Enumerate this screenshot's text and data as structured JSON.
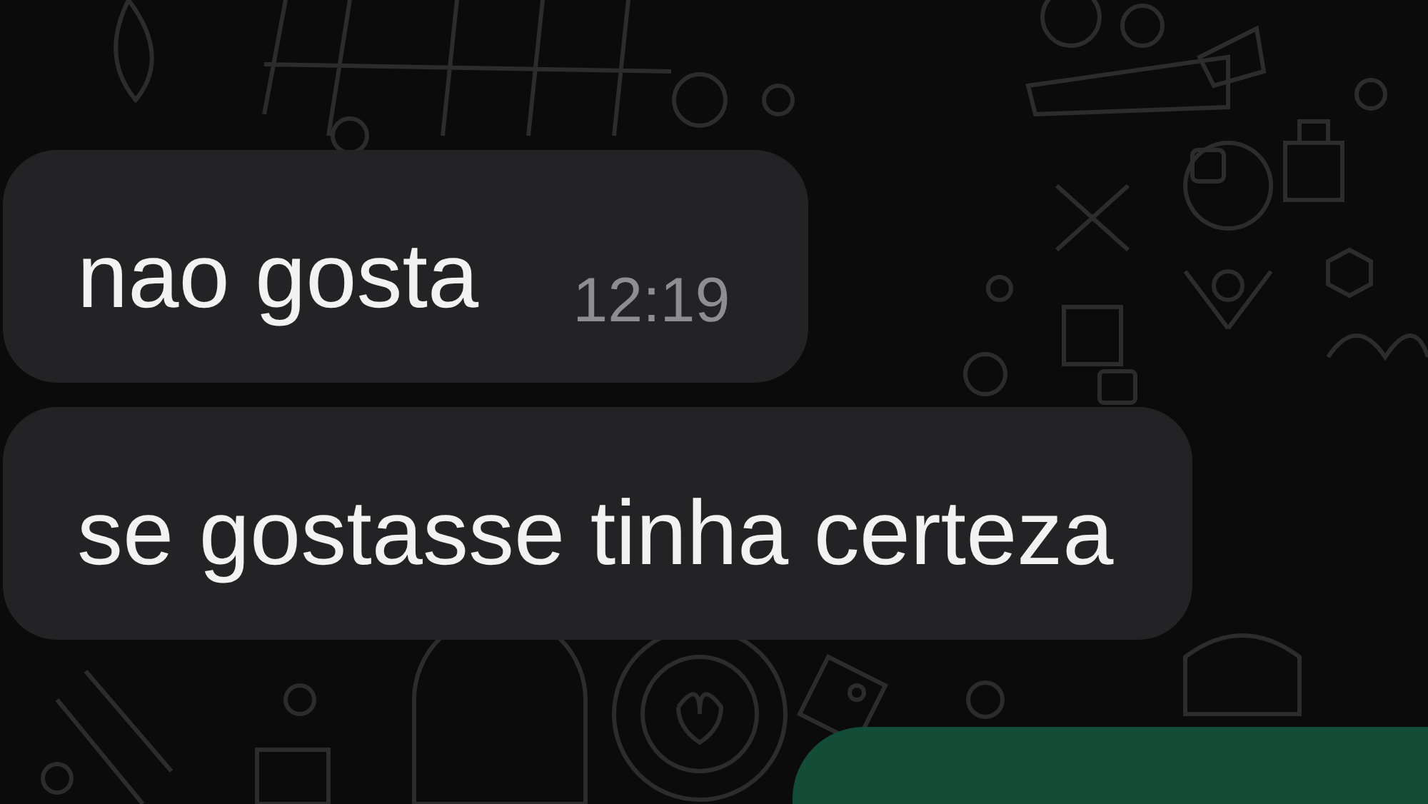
{
  "messages": [
    {
      "kind": "incoming",
      "text": "nao gosta",
      "time": "12:19"
    },
    {
      "kind": "incoming",
      "text": "se gostasse tinha certeza"
    },
    {
      "kind": "outgoing"
    }
  ]
}
